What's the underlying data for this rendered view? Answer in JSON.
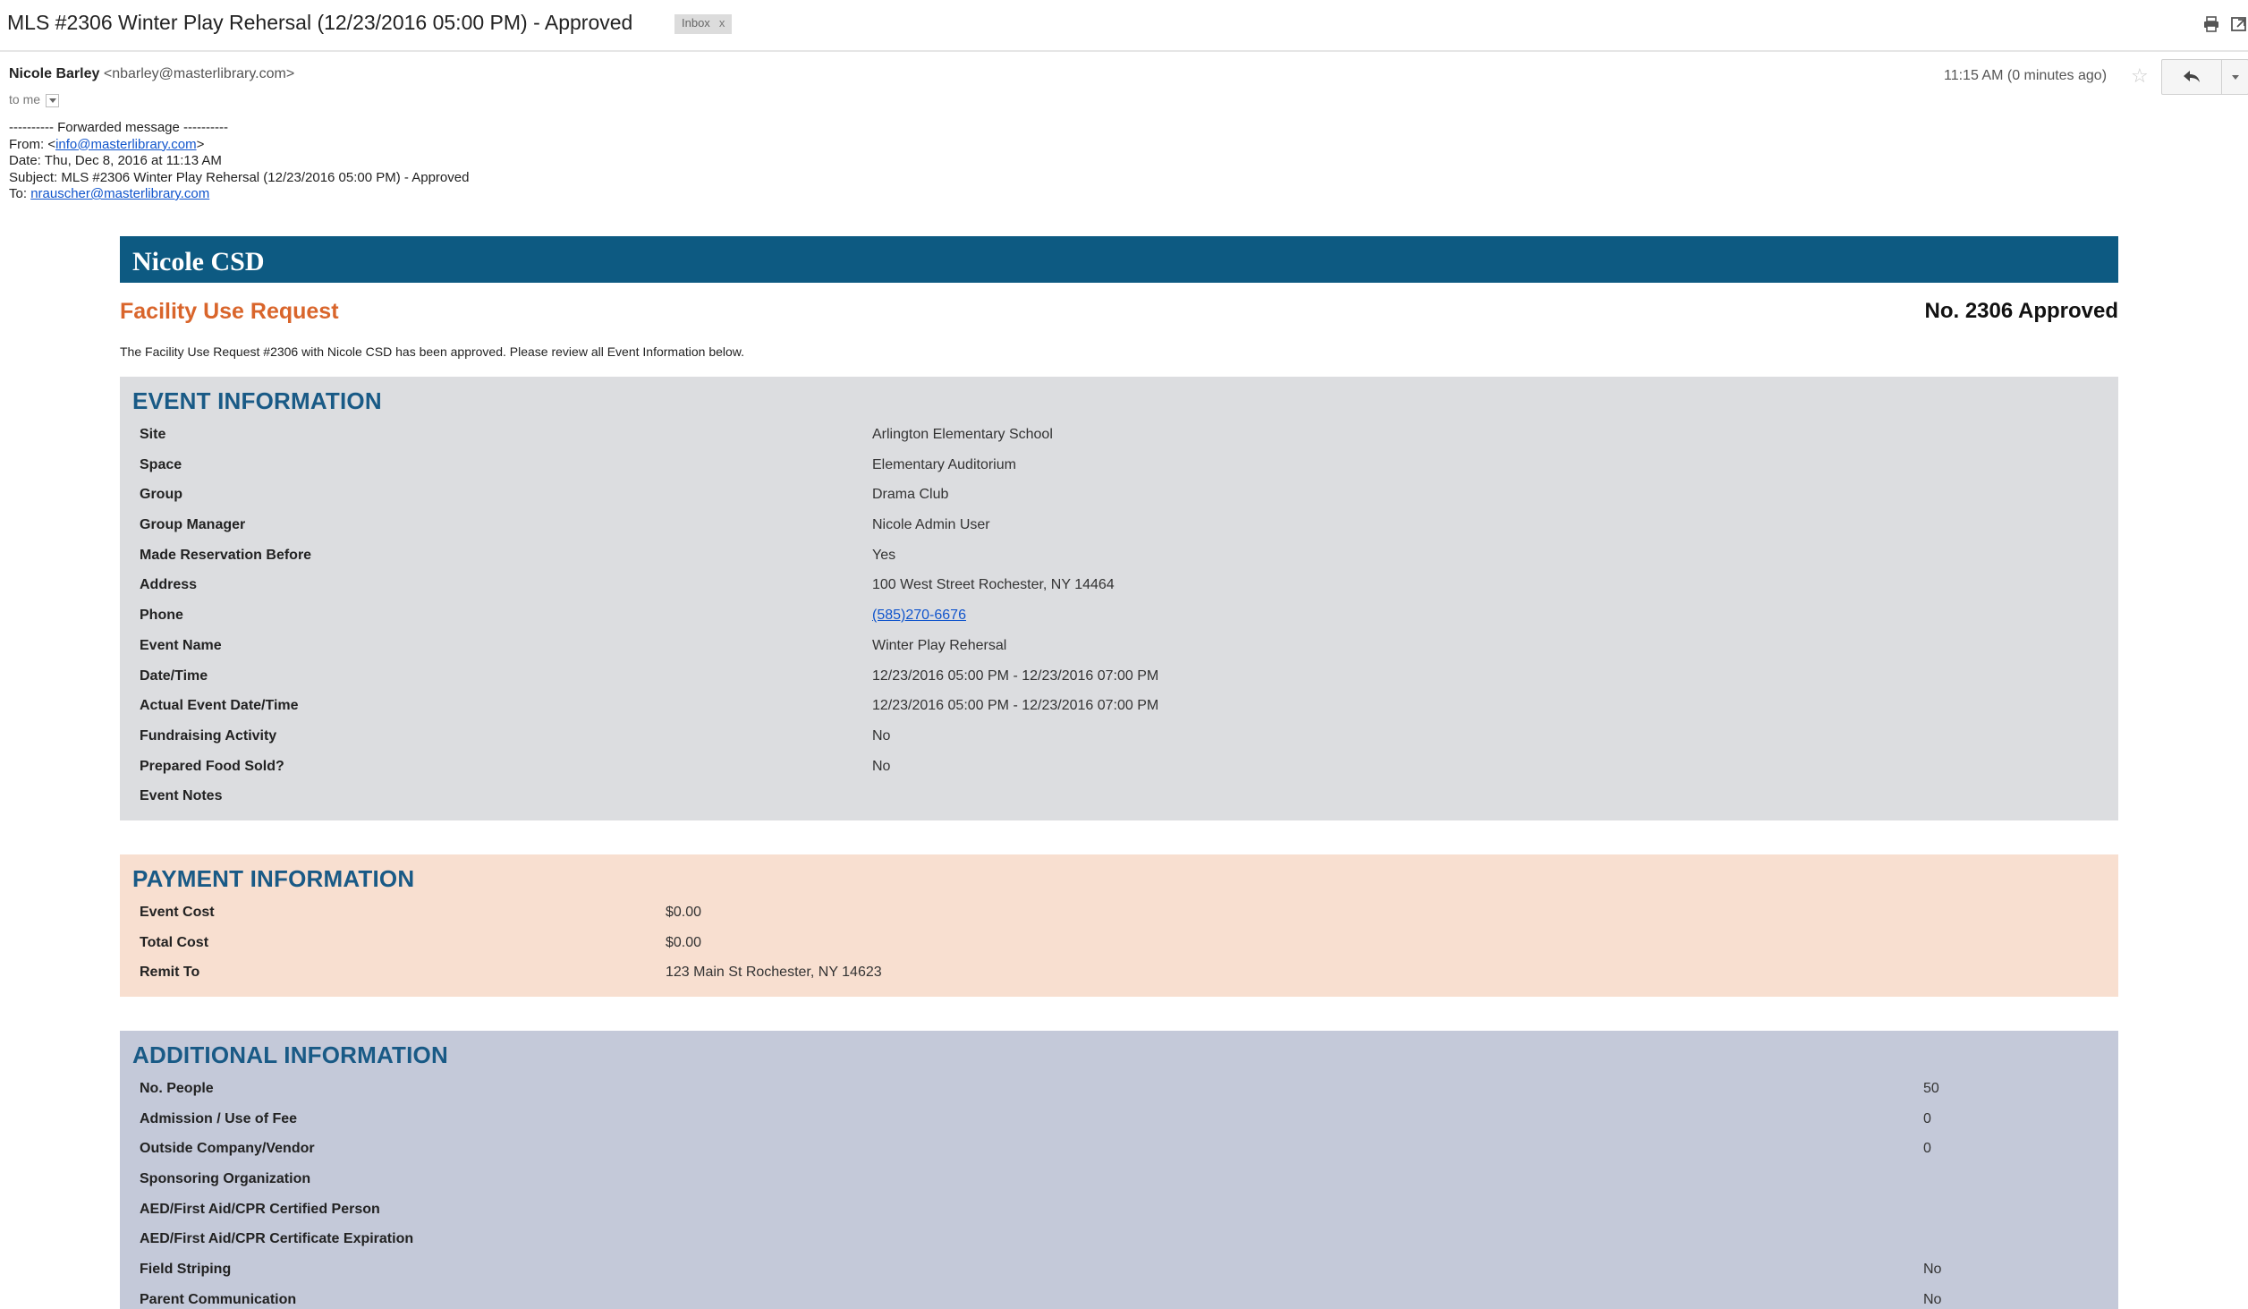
{
  "subject": {
    "title": "MLS #2306 Winter Play Rehersal (12/23/2016 05:00 PM) - Approved",
    "label_chip": "Inbox",
    "label_chip_close": "x"
  },
  "toolbar": {
    "print_icon": "printer-icon",
    "new_window_icon": "new-window-icon"
  },
  "message": {
    "sender_name": "Nicole Barley",
    "sender_email": "<nbarley@masterlibrary.com>",
    "to": "to me",
    "time": "11:15 AM (0 minutes ago)",
    "star_icon": "☆"
  },
  "forwarded": {
    "header": "---------- Forwarded message ----------",
    "from_label": "From: <",
    "from_email": "info@masterlibrary.com",
    "from_suffix": ">",
    "date": "Date: Thu, Dec 8, 2016 at 11:13 AM",
    "subject": "Subject: MLS #2306 Winter Play Rehersal (12/23/2016 05:00 PM) - Approved",
    "to_label": "To: ",
    "to_email": "nrauscher@masterlibrary.com"
  },
  "email_body": {
    "banner": "Nicole CSD",
    "title": "Facility Use Request",
    "number": "No. 2306 Approved",
    "intro": "The Facility Use Request #2306 with Nicole CSD has been approved. Please review all Event Information below."
  },
  "event_info": {
    "heading": "EVENT INFORMATION",
    "rows": [
      {
        "label": "Site",
        "value": "Arlington Elementary School"
      },
      {
        "label": "Space",
        "value": "Elementary Auditorium"
      },
      {
        "label": "Group",
        "value": "Drama Club"
      },
      {
        "label": "Group Manager",
        "value": "Nicole Admin User"
      },
      {
        "label": "Made Reservation Before",
        "value": "Yes"
      },
      {
        "label": "Address",
        "value": "100 West Street Rochester, NY 14464"
      },
      {
        "label": "Phone",
        "value": "(585)270-6676"
      },
      {
        "label": "Event Name",
        "value": "Winter Play Rehersal"
      },
      {
        "label": "Date/Time",
        "value": "12/23/2016 05:00 PM - 12/23/2016 07:00 PM"
      },
      {
        "label": "Actual Event Date/Time",
        "value": "12/23/2016 05:00 PM - 12/23/2016 07:00 PM"
      },
      {
        "label": "Fundraising Activity",
        "value": "No"
      },
      {
        "label": "Prepared Food Sold?",
        "value": "No"
      },
      {
        "label": "Event Notes",
        "value": ""
      }
    ]
  },
  "payment_info": {
    "heading": "PAYMENT INFORMATION",
    "rows": [
      {
        "label": "Event Cost",
        "value": "$0.00"
      },
      {
        "label": "Total Cost",
        "value": "$0.00"
      },
      {
        "label": "Remit To",
        "value": "123 Main St Rochester, NY 14623"
      }
    ]
  },
  "additional_info": {
    "heading": "ADDITIONAL INFORMATION",
    "rows": [
      {
        "label": "No. People",
        "value": "50"
      },
      {
        "label": "Admission / Use of Fee",
        "value": "0"
      },
      {
        "label": "Outside Company/Vendor",
        "value": "0"
      },
      {
        "label": "Sponsoring Organization",
        "value": ""
      },
      {
        "label": "AED/First Aid/CPR Certified Person",
        "value": ""
      },
      {
        "label": "AED/First Aid/CPR Certificate Expiration",
        "value": ""
      },
      {
        "label": "Field Striping",
        "value": "No"
      },
      {
        "label": "Parent Communication",
        "value": "No"
      }
    ]
  }
}
